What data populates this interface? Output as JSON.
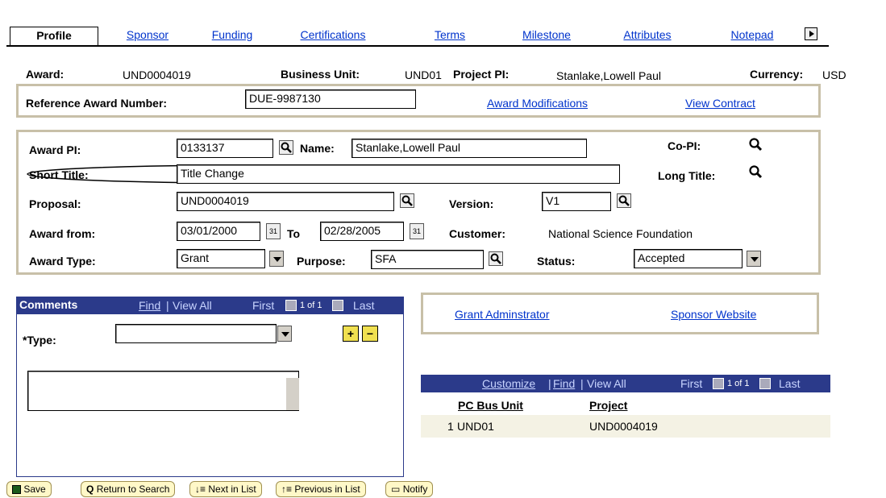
{
  "tabs": [
    {
      "label": "Profile",
      "active": true
    },
    {
      "label": "Sponsor"
    },
    {
      "label": "Funding"
    },
    {
      "label": "Certifications"
    },
    {
      "label": "Terms"
    },
    {
      "label": "Milestone"
    },
    {
      "label": "Attributes"
    },
    {
      "label": "Notepad"
    }
  ],
  "header": {
    "award_label": "Award:",
    "award_value": "UND0004019",
    "bu_label": "Business Unit:",
    "bu_value": "UND01",
    "pi_label": "Project PI:",
    "pi_value": "Stanlake,Lowell Paul",
    "currency_label": "Currency:",
    "currency_value": "USD"
  },
  "reference": {
    "label": "Reference Award Number:",
    "value": "DUE-9987130",
    "award_mods": "Award Modifications",
    "view_contract": "View Contract"
  },
  "details": {
    "award_pi_label": "Award PI:",
    "award_pi_value": "0133137",
    "name_label": "Name:",
    "name_value": "Stanlake,Lowell Paul",
    "copi_label": "Co-PI:",
    "short_title_label": "Short Title:",
    "short_title_value": "Title Change",
    "long_title_label": "Long Title:",
    "proposal_label": "Proposal:",
    "proposal_value": "UND0004019",
    "version_label": "Version:",
    "version_value": "V1",
    "award_from_label": "Award from:",
    "award_from_value": "03/01/2000",
    "to_label": "To",
    "to_value": "02/28/2005",
    "customer_label": "Customer:",
    "customer_value": "National Science Foundation",
    "award_type_label": "Award Type:",
    "award_type_value": "Grant",
    "purpose_label": "Purpose:",
    "purpose_value": "SFA",
    "status_label": "Status:",
    "status_value": "Accepted"
  },
  "comments": {
    "title": "Comments",
    "find": "Find",
    "view_all": "View All",
    "first": "First",
    "pager": "1 of 1",
    "last": "Last",
    "type_label": "*Type:",
    "type_value": ""
  },
  "links": {
    "grant_admin": "Grant Adminstrator",
    "sponsor_site": "Sponsor Website"
  },
  "project_grid": {
    "customize": "Customize",
    "find": "Find",
    "view_all": "View All",
    "first": "First",
    "pager": "1 of 1",
    "last": "Last",
    "columns": [
      "PC Bus Unit",
      "Project"
    ],
    "rows": [
      {
        "num": "1",
        "bu": "UND01",
        "project": "UND0004019"
      }
    ]
  },
  "toolbar": {
    "save": "Save",
    "return": "Return to Search",
    "next": "Next in List",
    "prev": "Previous in List",
    "notify": "Notify"
  }
}
